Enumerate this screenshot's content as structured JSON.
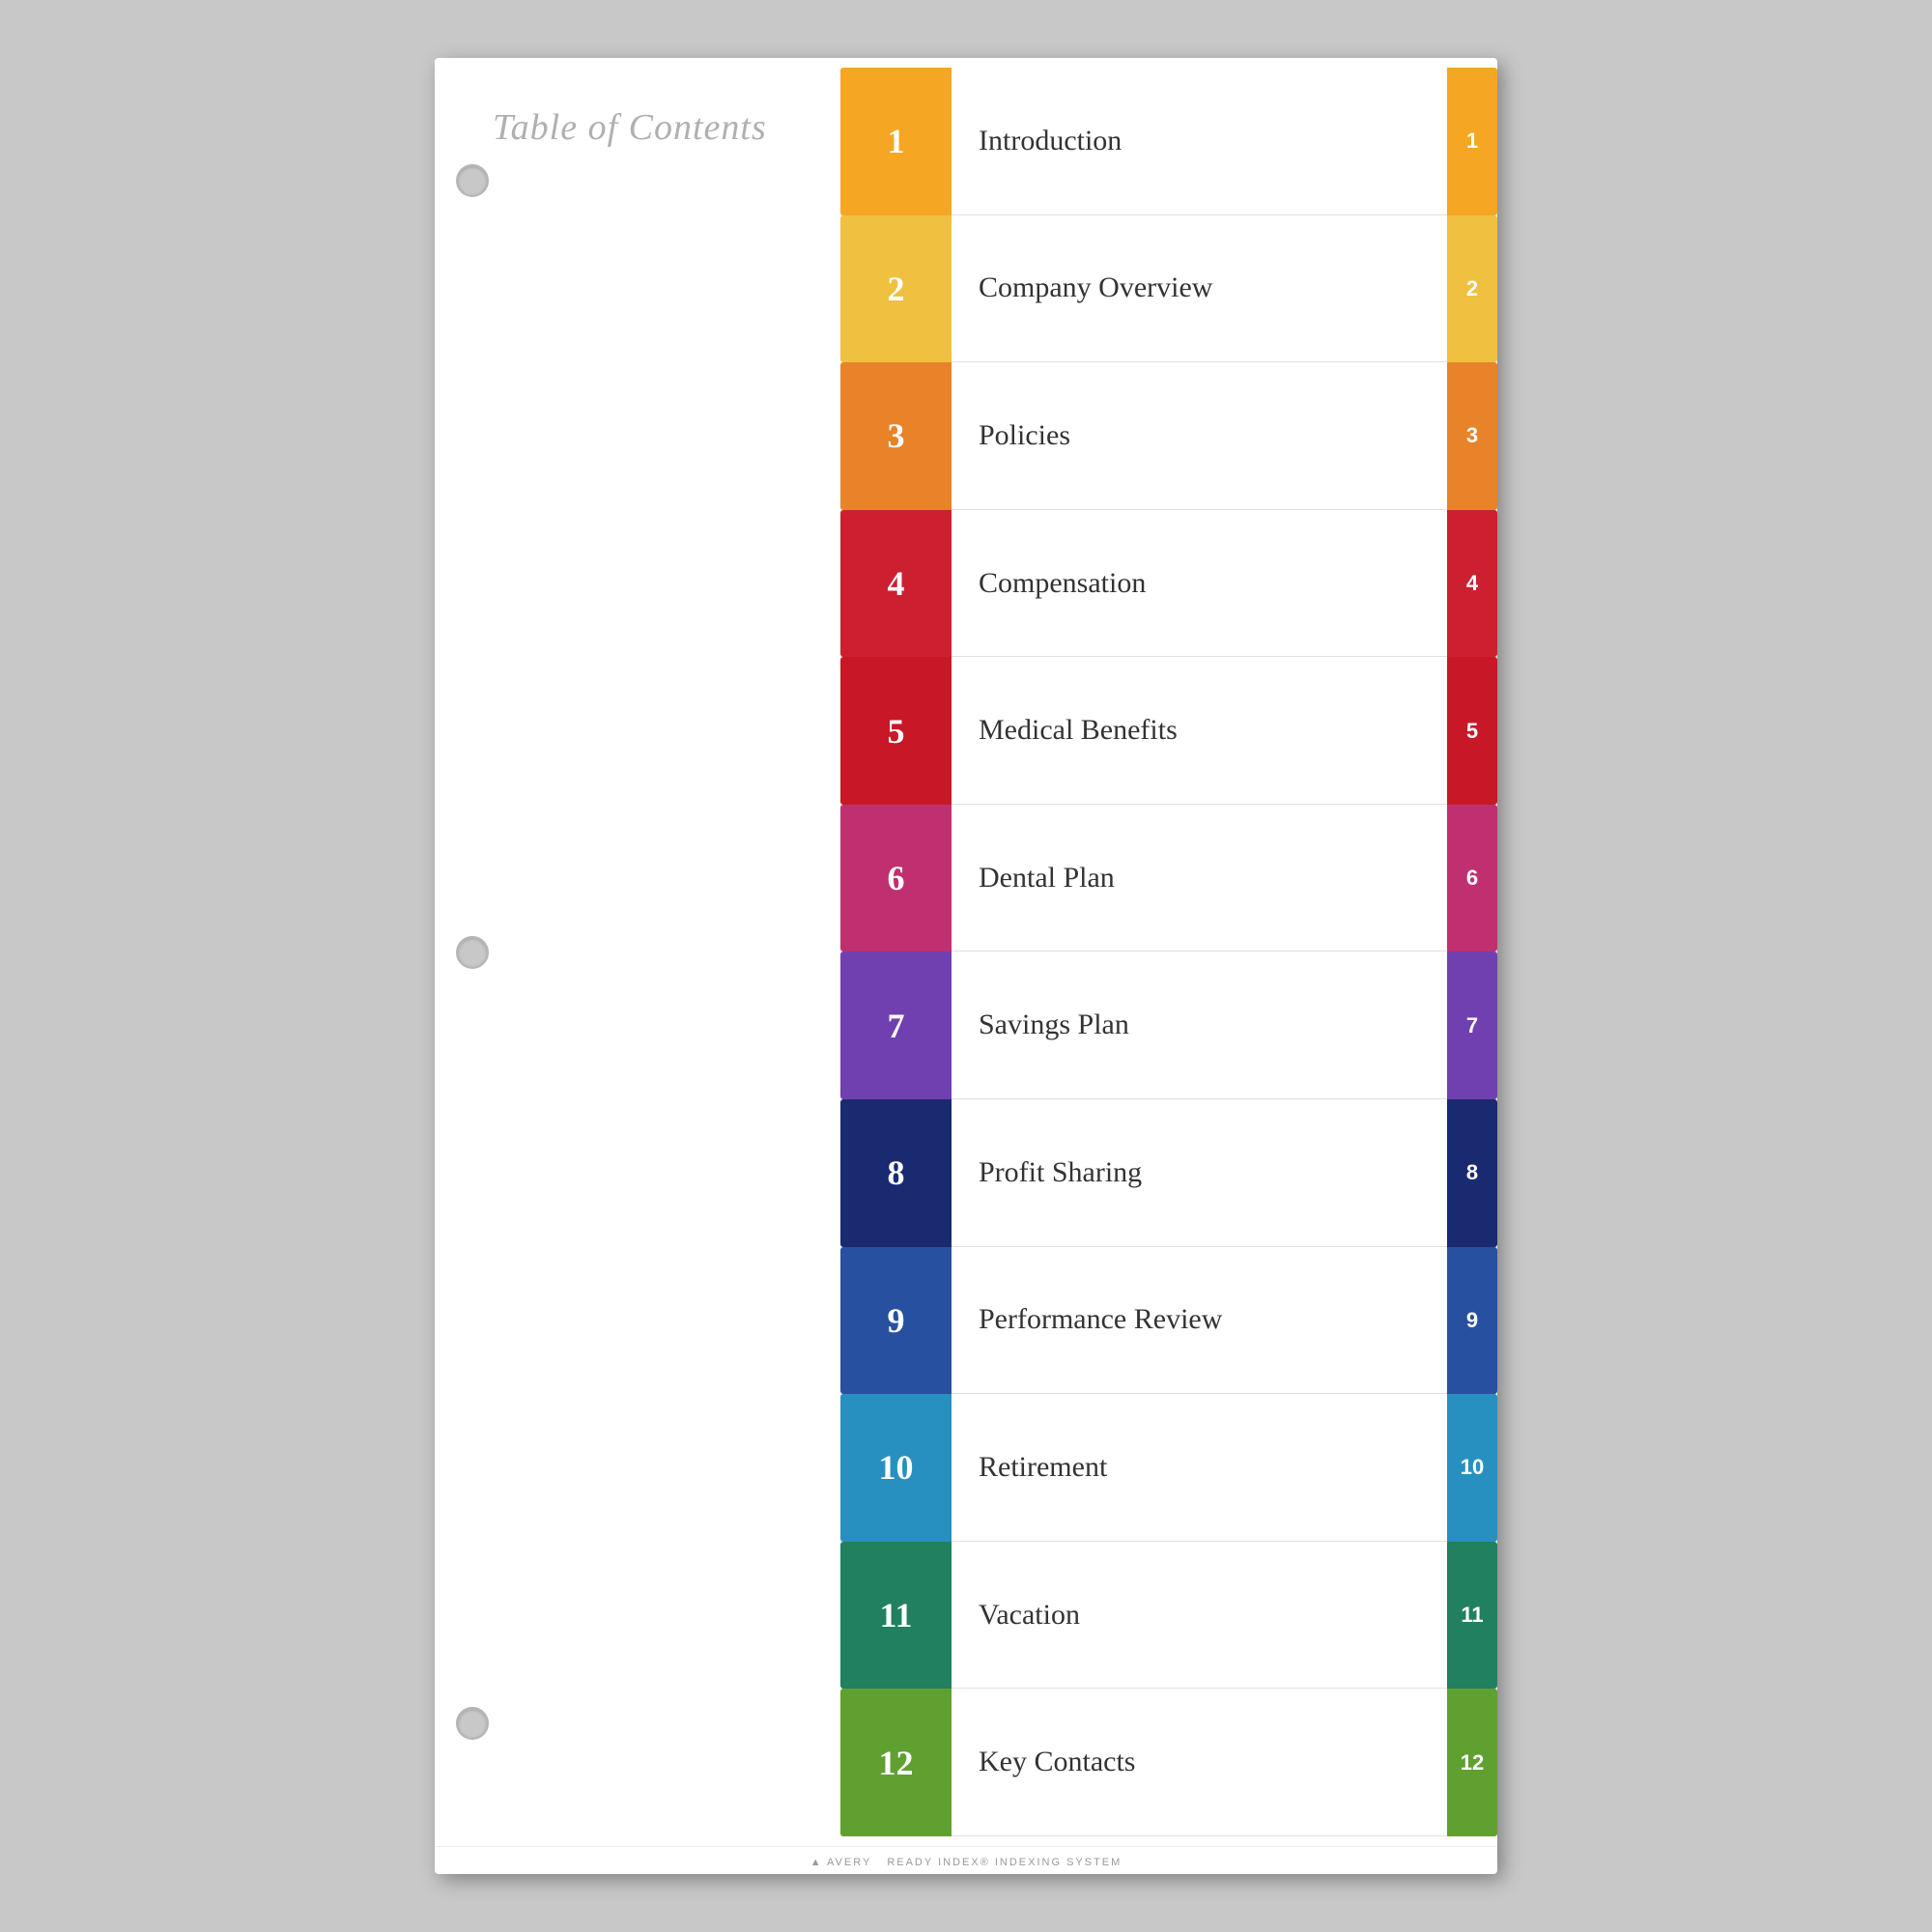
{
  "title": "Table of Contents",
  "tabs": [
    {
      "number": "1",
      "label": "Introduction",
      "color": "#F5A623",
      "sideColor": "#F5A623",
      "lighter": "#F7BA5A"
    },
    {
      "number": "2",
      "label": "Company Overview",
      "color": "#F0C040",
      "sideColor": "#F0C040",
      "lighter": "#F5D070"
    },
    {
      "number": "3",
      "label": "Policies",
      "color": "#E8832A",
      "sideColor": "#E8832A",
      "lighter": "#EDA060"
    },
    {
      "number": "4",
      "label": "Compensation",
      "color": "#CC2030",
      "sideColor": "#CC2030",
      "lighter": "#D55060"
    },
    {
      "number": "5",
      "label": "Medical Benefits",
      "color": "#C81828",
      "sideColor": "#C81828",
      "lighter": "#D54858"
    },
    {
      "number": "6",
      "label": "Dental Plan",
      "color": "#C03070",
      "sideColor": "#C03070",
      "lighter": "#D06090"
    },
    {
      "number": "7",
      "label": "Savings Plan",
      "color": "#7040B0",
      "sideColor": "#7040B0",
      "lighter": "#9060C8"
    },
    {
      "number": "8",
      "label": "Profit Sharing",
      "color": "#1A2A70",
      "sideColor": "#1A2A70",
      "lighter": "#2A3A80"
    },
    {
      "number": "9",
      "label": "Performance Review",
      "color": "#2850A0",
      "sideColor": "#2850A0",
      "lighter": "#4070B8"
    },
    {
      "number": "10",
      "label": "Retirement",
      "color": "#2890C0",
      "sideColor": "#2890C0",
      "lighter": "#50A8D0"
    },
    {
      "number": "11",
      "label": "Vacation",
      "color": "#208060",
      "sideColor": "#208060",
      "lighter": "#40A080"
    },
    {
      "number": "12",
      "label": "Key Contacts",
      "color": "#60A030",
      "sideColor": "#60A030",
      "lighter": "#80C050"
    }
  ],
  "footer": {
    "brand": "AVERY",
    "product": "READY INDEX® INDEXING SYSTEM"
  }
}
